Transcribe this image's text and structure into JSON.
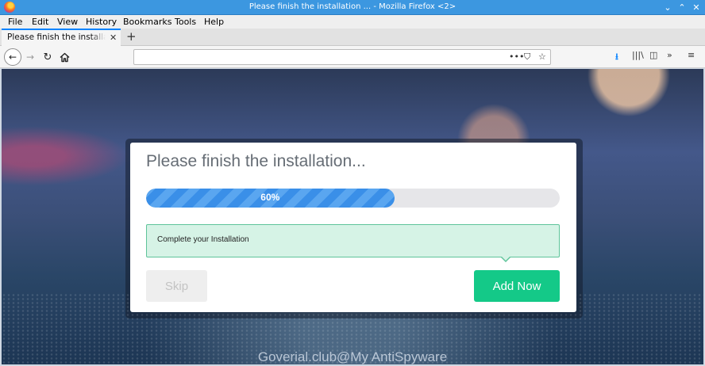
{
  "window": {
    "title": "Please finish the installation ... - Mozilla Firefox <2>",
    "minimize_glyph": "⌄",
    "maximize_glyph": "⌃",
    "close_glyph": "✕",
    "firefox_icon": "firefox-logo-icon"
  },
  "menu": [
    "File",
    "Edit",
    "View",
    "History",
    "Bookmarks",
    "Tools",
    "Help"
  ],
  "tabs": [
    {
      "label": "Please finish the installation ...",
      "close_glyph": "✕",
      "active": true
    }
  ],
  "new_tab_glyph": "+",
  "nav": {
    "back_glyph": "←",
    "forward_glyph": "→",
    "reload_glyph": "↻",
    "url_value": "",
    "page_actions_glyph": "•••",
    "pocket_glyph": "⛉",
    "bookmark_star_glyph": "☆",
    "downloads_glyph": "⭳",
    "library_glyph": "|||\\",
    "sidebar_glyph": "◫",
    "overflow_glyph": "»",
    "menu_glyph": "≡"
  },
  "modal": {
    "title": "Please finish the installation...",
    "progress_percent": 60,
    "progress_label": "60%",
    "message": "Complete your Installation",
    "skip_label": "Skip",
    "add_label": "Add Now"
  },
  "watermark": "Goverial.club@My AntiSpyware",
  "colors": {
    "titlebar": "#3c97e0",
    "progress_fill": "#3a8fe8",
    "add_button": "#14c988",
    "message_bg": "#d6f3e6"
  }
}
